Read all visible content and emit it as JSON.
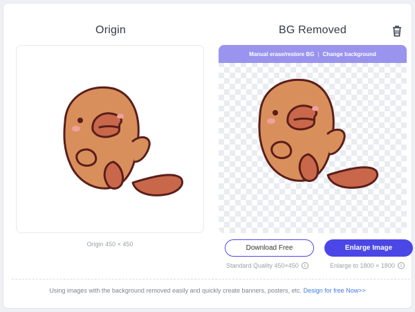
{
  "columns": {
    "origin_title": "Origin",
    "result_title": "BG Removed"
  },
  "toolbar": {
    "manual_erase": "Manual erase/restore BG",
    "separator": "|",
    "change_background": "Change background"
  },
  "origin": {
    "caption": "Origin 450 × 450"
  },
  "actions": {
    "download_label": "Download Free",
    "enlarge_label": "Enlarge Image",
    "download_note": "Standard Quality 450×450",
    "enlarge_note": "Enlarge to 1800 × 1800"
  },
  "footer": {
    "text": "Using images with the background removed easily and quickly create banners, posters, etc.",
    "link": "Design for free Now>>"
  },
  "icons": {
    "delete": "trash-icon",
    "info": "info-icon"
  },
  "colors": {
    "accent": "#4a47e6",
    "toolbar": "#9a94ee",
    "link": "#3d7be8",
    "mascot_body": "#d98f5b",
    "mascot_outline": "#5a1e1a"
  }
}
